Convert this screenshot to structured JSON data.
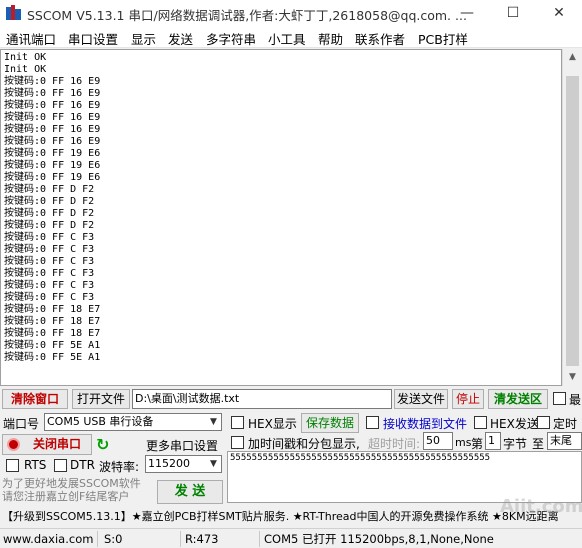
{
  "window": {
    "title": "SSCOM V5.13.1 串口/网络数据调试器,作者:大虾丁丁,2618058@qq.com. ...",
    "minimize": "—",
    "maximize": "☐",
    "close": "✕"
  },
  "menu": [
    "通讯端口",
    "串口设置",
    "显示",
    "发送",
    "多字符串",
    "小工具",
    "帮助",
    "联系作者",
    "PCB打样"
  ],
  "console": {
    "lines": [
      "Init OK",
      "Init OK",
      "按键码:0 FF 16 E9",
      "按键码:0 FF 16 E9",
      "按键码:0 FF 16 E9",
      "按键码:0 FF 16 E9",
      "按键码:0 FF 16 E9",
      "按键码:0 FF 16 E9",
      "按键码:0 FF 19 E6",
      "按键码:0 FF 19 E6",
      "按键码:0 FF 19 E6",
      "按键码:0 FF D F2",
      "按键码:0 FF D F2",
      "按键码:0 FF D F2",
      "按键码:0 FF D F2",
      "按键码:0 FF C F3",
      "按键码:0 FF C F3",
      "按键码:0 FF C F3",
      "按键码:0 FF C F3",
      "按键码:0 FF C F3",
      "按键码:0 FF C F3",
      "按键码:0 FF 18 E7",
      "按键码:0 FF 18 E7",
      "按键码:0 FF 18 E7",
      "按键码:0 FF 5E A1",
      "按键码:0 FF 5E A1"
    ]
  },
  "toolbar": {
    "clear_window": "清除窗口",
    "open_file": "打开文件",
    "file_path": "D:\\桌面\\测试数据.txt",
    "send_file": "发送文件",
    "stop": "停止",
    "clear_send_area": "清发送区",
    "last": "最"
  },
  "port": {
    "port_label": "端口号",
    "port_value": "COM5 USB 串行设备",
    "close_port": "关闭串口",
    "more_settings": "更多串口设置",
    "rts": "RTS",
    "dtr": "DTR",
    "baud_label": "波特率:",
    "baud_value": "115200"
  },
  "options": {
    "hex_display": "HEX显示",
    "save_data": "保存数据",
    "recv_to_file": "接收数据到文件",
    "hex_send": "HEX发送",
    "timed_send": "定时",
    "timestamp": "加时间戳和分包显示,",
    "timeout_label": "超时时间:",
    "timeout_value": "50",
    "ms": "ms",
    "nth": "第",
    "byte_index": "1",
    "byte_label": "字节",
    "to": "至",
    "end": "末尾"
  },
  "send_text": "555555555555555555555555555555555555555555555555",
  "promo_left": "为了更好地发展SSCOM软件\n请您注册嘉立创F结尾客户",
  "send_button": "发 送",
  "promo_bar": "【升级到SSCOM5.13.1】★嘉立创PCB打样SMT贴片服务. ★RT-Thread中国人的开源免费操作系统 ★8KM远距离",
  "status": {
    "website": "www.daxia.com",
    "s": "S:0",
    "r": "R:473",
    "port_status": "COM5 已打开  115200bps,8,1,None,None"
  },
  "watermark": "Aiit.com",
  "colors": {
    "red_btn": "#c00000",
    "green_btn": "#008000",
    "link_blue": "#0000cc"
  }
}
